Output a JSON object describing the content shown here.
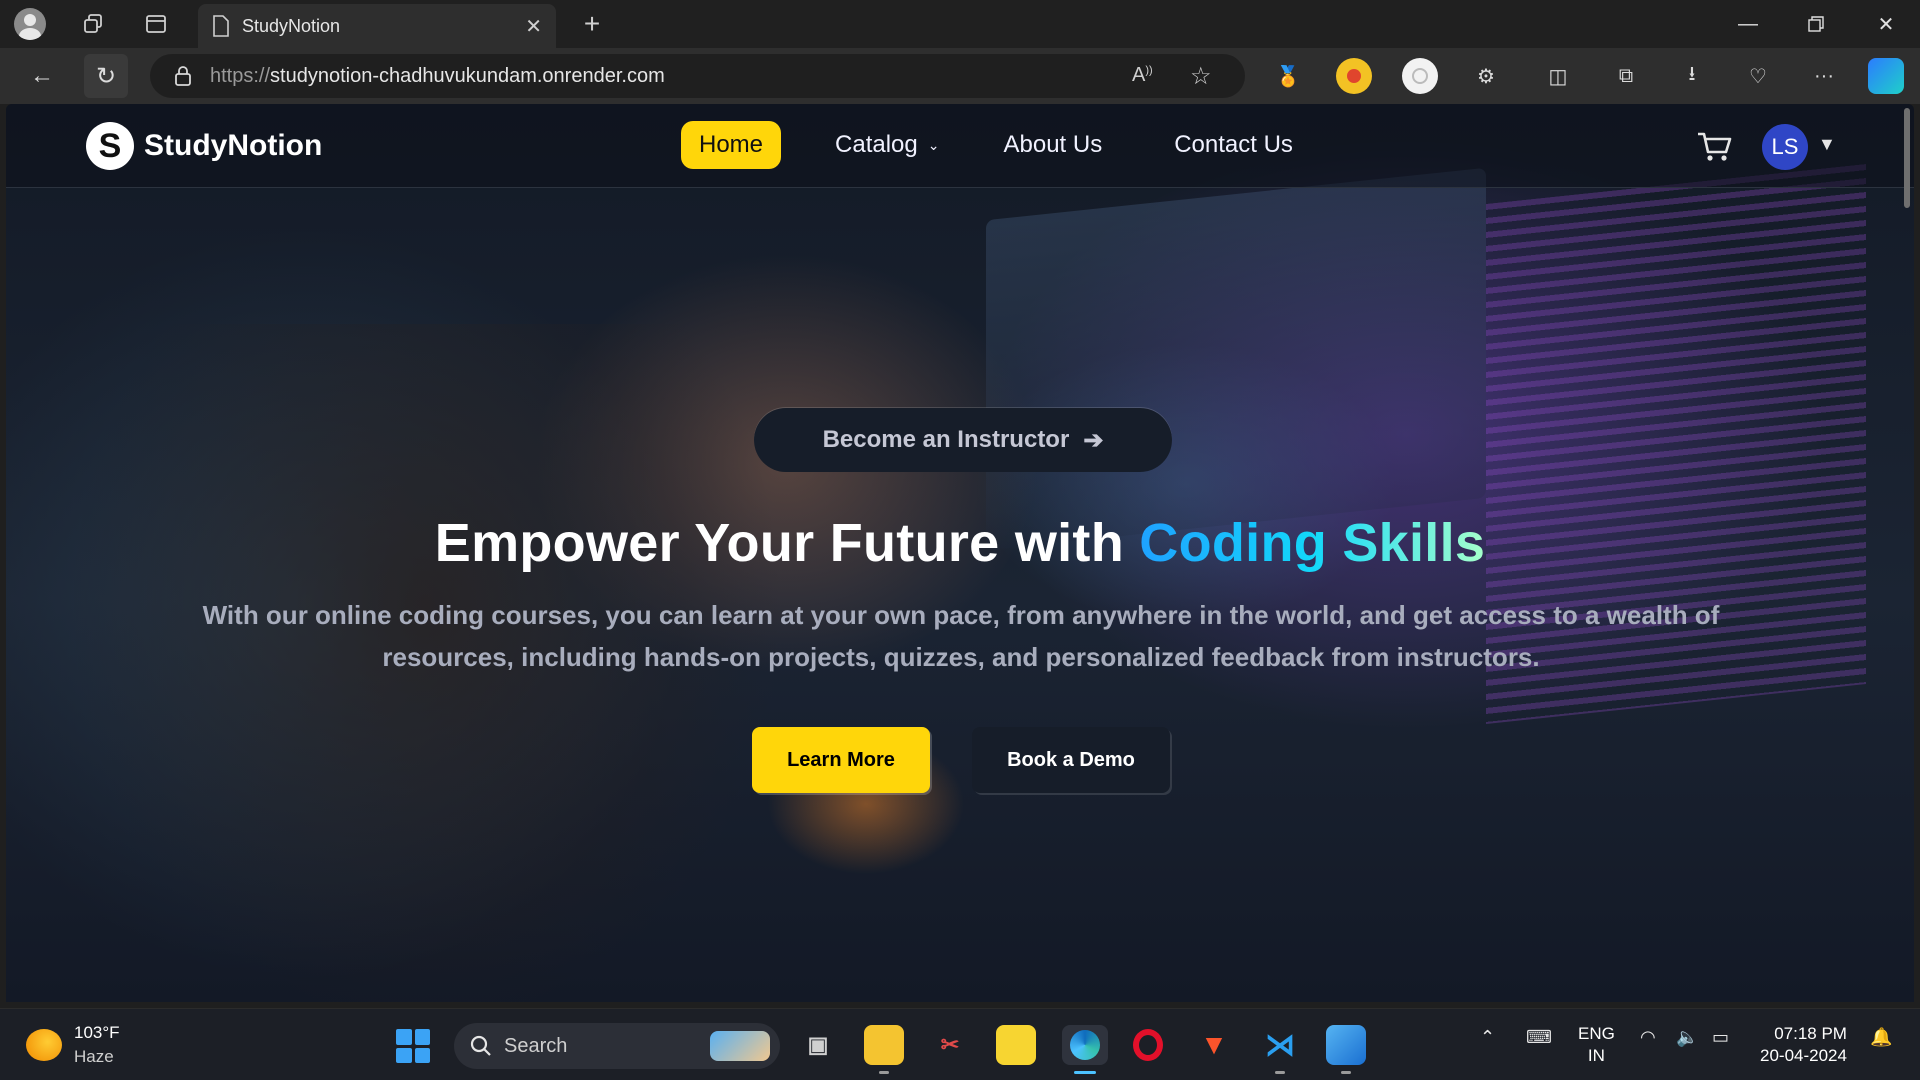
{
  "browser": {
    "tab_title": "StudyNotion",
    "url_scheme": "https://",
    "url_host": "studynotion-chadhuvukundam.onrender.com"
  },
  "site": {
    "logo_text": "StudyNotion",
    "logo_letter": "S",
    "nav": {
      "home": "Home",
      "catalog": "Catalog",
      "about": "About Us",
      "contact": "Contact Us"
    },
    "user_initials": "LS"
  },
  "hero": {
    "instructor_cta": "Become an Instructor",
    "headline_plain": "Empower Your Future with ",
    "headline_highlight": "Coding Skills",
    "subtext": "With our online coding courses, you can learn at your own pace, from anywhere in the world, and get access to a wealth of resources, including hands-on projects, quizzes, and personalized feedback from instructors.",
    "learn_more": "Learn More",
    "book_demo": "Book a Demo"
  },
  "taskbar": {
    "weather_temp": "103°F",
    "weather_cond": "Haze",
    "search_placeholder": "Search",
    "lang_line1": "ENG",
    "lang_line2": "IN",
    "time": "07:18 PM",
    "date": "20-04-2024"
  },
  "colors": {
    "accent_yellow": "#ffd60a",
    "avatar_blue": "#2f46c6",
    "edge_blue": "#4cc2ff"
  }
}
